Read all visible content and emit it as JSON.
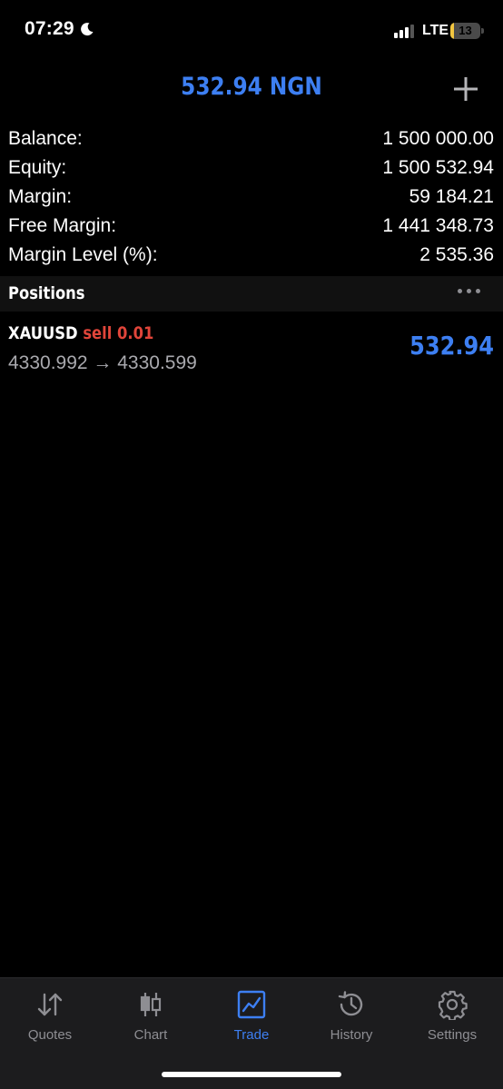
{
  "status_bar": {
    "time": "07:29",
    "network": "LTE",
    "battery": "13",
    "battery_color": "#f2c640"
  },
  "header": {
    "title": "532.94 NGN",
    "add_icon": "plus-icon"
  },
  "account": [
    {
      "label": "Balance:",
      "value": "1 500 000.00"
    },
    {
      "label": "Equity:",
      "value": "1 500 532.94"
    },
    {
      "label": "Margin:",
      "value": "59 184.21"
    },
    {
      "label": "Free Margin:",
      "value": "1 441 348.73"
    },
    {
      "label": "Margin Level (%):",
      "value": "2 535.36"
    }
  ],
  "positions": {
    "title": "Positions",
    "items": [
      {
        "symbol": "XAUUSD",
        "side": "sell 0.01",
        "prices": "4330.992 → 4330.599",
        "profit": "532.94"
      }
    ]
  },
  "tabs": [
    {
      "label": "Quotes",
      "icon": "arrows-updown-icon"
    },
    {
      "label": "Chart",
      "icon": "candlestick-icon"
    },
    {
      "label": "Trade",
      "icon": "trade-chart-icon",
      "active": true
    },
    {
      "label": "History",
      "icon": "history-clock-icon"
    },
    {
      "label": "Settings",
      "icon": "gear-icon"
    }
  ],
  "colors": {
    "accent": "#3d7ff2",
    "sell": "#e0453a",
    "inactive": "#8e8e93"
  }
}
